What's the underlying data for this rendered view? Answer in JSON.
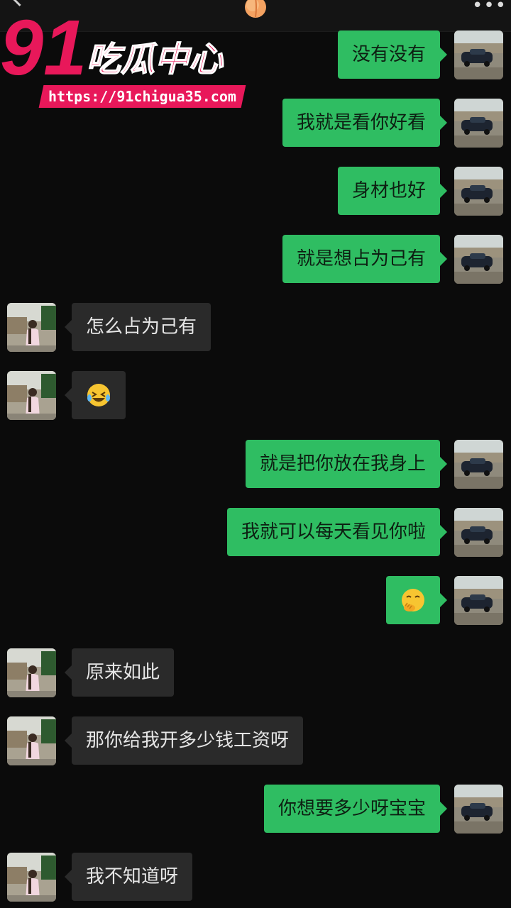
{
  "header": {
    "back_icon": "chevron-left-icon",
    "center_icon": "peach-emoji-icon",
    "more_label": "•••"
  },
  "watermark": {
    "number": "91",
    "brand": "吃瓜中心",
    "url": "https://91chigua35.com",
    "accent_color": "#e8185a"
  },
  "colors": {
    "sent_bubble": "#2fbd62",
    "received_bubble": "#2a2a2a",
    "background": "#0b0b0b"
  },
  "messages": [
    {
      "from": "me",
      "text": "没有没有"
    },
    {
      "from": "me",
      "text": "我就是看你好看"
    },
    {
      "from": "me",
      "text": "身材也好"
    },
    {
      "from": "me",
      "text": "就是想占为己有"
    },
    {
      "from": "her",
      "text": "怎么占为己有"
    },
    {
      "from": "her",
      "text": "",
      "emoji": "laughing-crying-emoji"
    },
    {
      "from": "me",
      "text": "就是把你放在我身上"
    },
    {
      "from": "me",
      "text": "我就可以每天看见你啦"
    },
    {
      "from": "me",
      "text": "",
      "emoji": "hand-over-mouth-emoji"
    },
    {
      "from": "her",
      "text": "原来如此"
    },
    {
      "from": "her",
      "text": "那你给我开多少钱工资呀"
    },
    {
      "from": "me",
      "text": "你想要多少呀宝宝"
    },
    {
      "from": "her",
      "text": "我不知道呀"
    }
  ]
}
